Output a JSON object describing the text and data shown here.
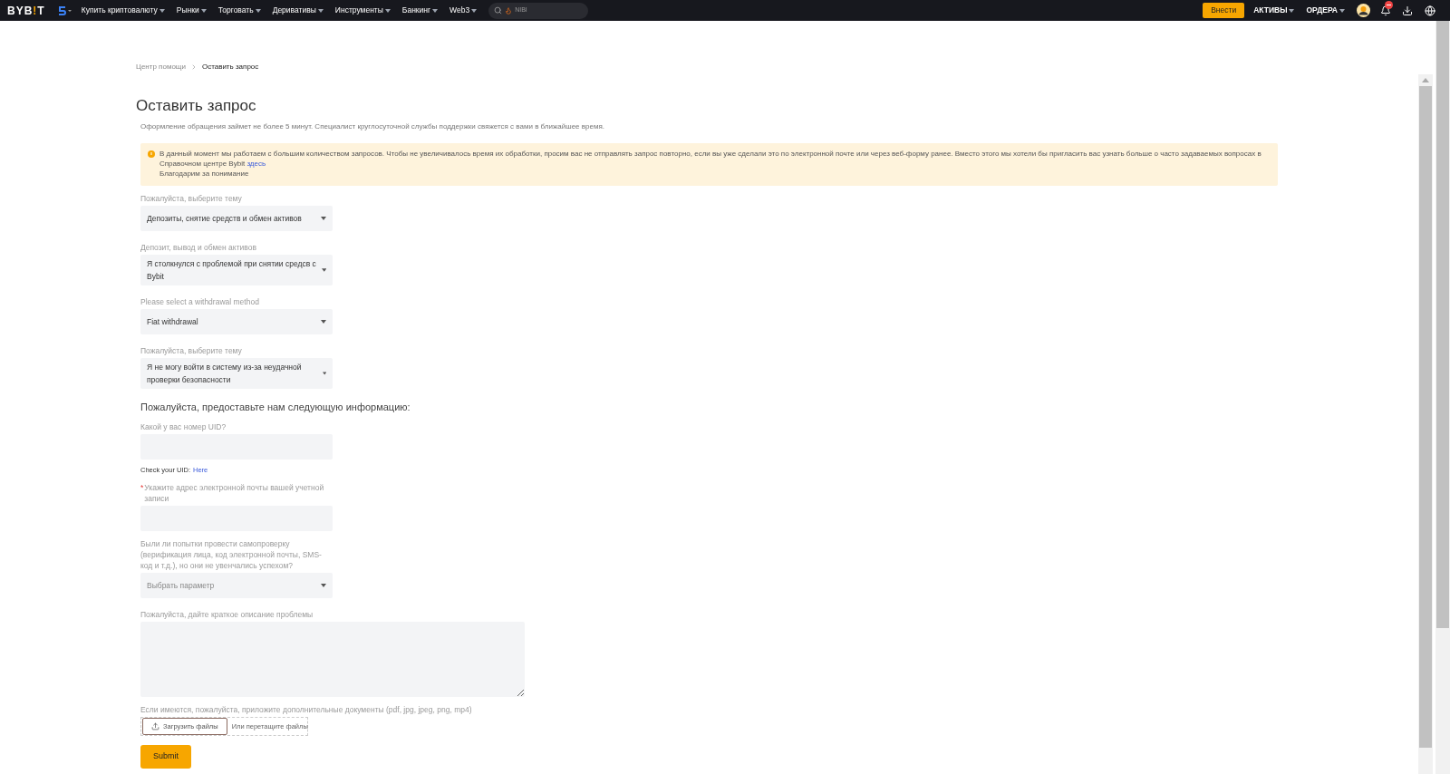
{
  "nav": {
    "logo": "BYB!T",
    "items": [
      {
        "label": "Купить криптовалюту"
      },
      {
        "label": "Рынки"
      },
      {
        "label": "Торговать"
      },
      {
        "label": "Деривативы"
      },
      {
        "label": "Инструменты"
      },
      {
        "label": "Банкинг"
      },
      {
        "label": "Web3"
      }
    ],
    "search": {
      "placeholder": "NIBI"
    },
    "deposit_button": "Внести",
    "right_items": [
      {
        "label": "АКТИВЫ"
      },
      {
        "label": "ОРДЕРА"
      }
    ]
  },
  "breadcrumb": [
    {
      "label": "Центр помощи",
      "current": false
    },
    {
      "label": "Оставить запрос",
      "current": true
    }
  ],
  "title": "Оставить запрос",
  "subtitle": "Оформление обращения займет не более 5 минут. Специалист круглосуточной службы поддержки свяжется с вами в ближайшее время.",
  "notice": {
    "text": "В данный момент мы работаем с большим количеством запросов. Чтобы не увеличивалось время их обработки, просим вас не отправлять запрос повторно, если вы уже сделали это по электронной почте или через веб-форму ранее. Вместо этого мы хотели бы пригласить вас узнать больше о часто задаваемых вопросах в Справочном центре Bybit",
    "link": "здесь",
    "thanks": "Благодарим за понимание"
  },
  "fields": [
    {
      "kind": "select",
      "label": "Пожалуйста, выберите тему",
      "value": "Депозиты, снятие средств и обмен активов"
    },
    {
      "kind": "select",
      "label": "Депозит, вывод и обмен активов",
      "value": "Я столкнулся с проблемой при снятии средсв с Bybit"
    },
    {
      "kind": "select",
      "label": "Please select a withdrawal method",
      "value": "Fiat withdrawal"
    },
    {
      "kind": "select",
      "label": "Пожалуйста, выберите тему",
      "value": "Я не могу войти в систему из-за неудачной проверки безопасности"
    },
    {
      "kind": "heading",
      "label": "Пожалуйста, предоставьте нам следующую информацию:"
    },
    {
      "kind": "text",
      "label": "Какой у вас номер UID?",
      "hint": "Check your UID:",
      "hint_link": "Here"
    },
    {
      "kind": "text",
      "label": "Укажите адрес электронной почты вашей учетной записи",
      "required_mark": "*"
    },
    {
      "kind": "select",
      "label": "Были ли попытки провести самопроверку (верификация лица, код электронной почты, SMS-код и т.д.), но они не увенчались успехом?",
      "placeholder": "Выбрать параметр"
    },
    {
      "kind": "textarea",
      "label": "Пожалуйста, дайте краткое описание проблемы"
    },
    {
      "kind": "upload",
      "label": "Если имеются, пожалуйста, приложите дополнительные документы (pdf, jpg, jpeg, png, mp4)",
      "button": "Загрузить файлы",
      "drop_text": "Или перетащите файлы"
    }
  ],
  "submit": "Submit"
}
